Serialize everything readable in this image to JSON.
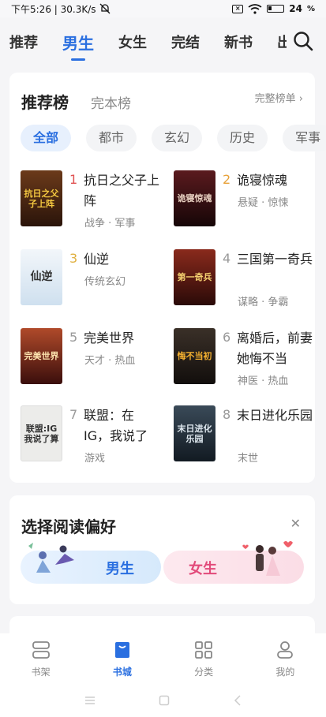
{
  "status_bar": {
    "time_speed": "下午5:26 | 30.3K/s",
    "battery": "24"
  },
  "nav": {
    "tabs": [
      "推荐",
      "男生",
      "女生",
      "完结",
      "新书",
      "出"
    ],
    "active_tab": "男生"
  },
  "ranking": {
    "title": "推荐榜",
    "subtitle": "完本榜",
    "full_list": "完整榜单 ›",
    "chips": [
      "全部",
      "都市",
      "玄幻",
      "历史",
      "军事"
    ],
    "books": [
      {
        "rank": "1",
        "title": "抗日之父子上阵",
        "tags": "战争 · 军事",
        "cover_text": "抗日之父子上阵",
        "cover_color": "#3a2012",
        "rank_color": "#e05252"
      },
      {
        "rank": "2",
        "title": "诡寝惊魂",
        "tags": "悬疑 · 惊悚",
        "cover_text": "诡寝惊魂",
        "cover_color": "#3a0d12",
        "rank_color": "#e8a23a"
      },
      {
        "rank": "3",
        "title": "仙逆",
        "tags": "传统玄幻",
        "cover_text": "仙逆",
        "cover_color": "#e4eef7",
        "rank_color": "#e0b040"
      },
      {
        "rank": "4",
        "title": "三国第一奇兵",
        "tags": "谋略 · 争霸",
        "cover_text": "第一奇兵",
        "cover_color": "#4a1510",
        "rank_color": "#999999"
      },
      {
        "rank": "5",
        "title": "完美世界",
        "tags": "天才 · 热血",
        "cover_text": "完美世界",
        "cover_color": "#6a1a16",
        "rank_color": "#999999"
      },
      {
        "rank": "6",
        "title": "离婚后，前妻她悔不当",
        "tags": "神医 · 热血",
        "cover_text": "悔不当初",
        "cover_color": "#1d1a18",
        "rank_color": "#999999"
      },
      {
        "rank": "7",
        "title": "联盟：在IG，我说了",
        "tags": "游戏",
        "cover_text": "联盟:IG 我说了算",
        "cover_color": "#ececea",
        "rank_color": "#999999"
      },
      {
        "rank": "8",
        "title": "末日进化乐园",
        "tags": "末世",
        "cover_text": "末日进化乐园",
        "cover_color": "#253340",
        "rank_color": "#999999"
      }
    ]
  },
  "preference": {
    "title": "选择阅读偏好",
    "male": "男生",
    "female": "女生"
  },
  "bottom_nav": [
    {
      "label": "书架",
      "icon": "bookshelf-icon"
    },
    {
      "label": "书城",
      "icon": "bookstore-icon"
    },
    {
      "label": "分类",
      "icon": "category-icon"
    },
    {
      "label": "我的",
      "icon": "profile-icon"
    }
  ],
  "colors": {
    "accent": "#2a6fe0",
    "rank1": "#e05252",
    "rank2": "#e8a23a",
    "rank3": "#e0b040"
  }
}
